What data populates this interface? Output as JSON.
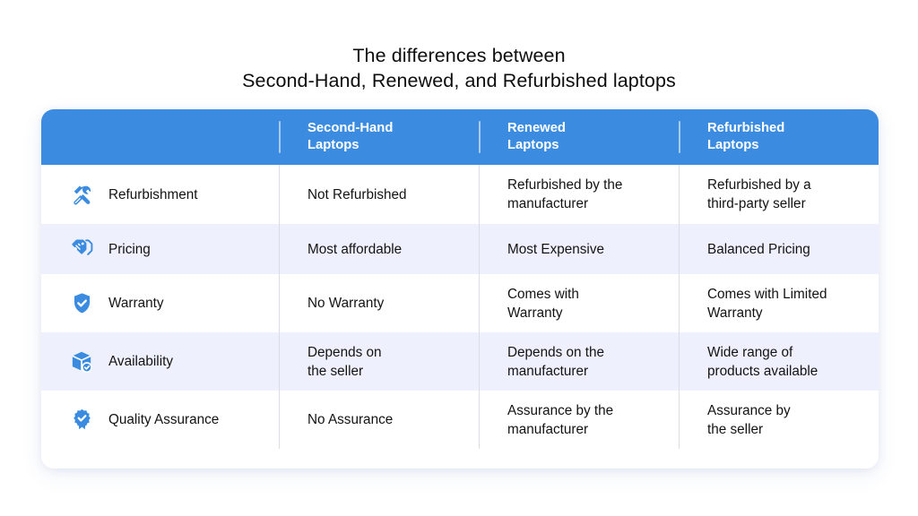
{
  "title": {
    "line1": "The differences between",
    "line2": "Second-Hand, Renewed, and Refurbished laptops"
  },
  "colors": {
    "header_blue": "#3b8ce0",
    "alt_row": "#eef1fd",
    "icon_blue": "#3b8ce0",
    "text": "#131313",
    "divider": "#dcdde3"
  },
  "table": {
    "headers": {
      "feature": "",
      "col1_line1": "Second-Hand",
      "col1_line2": "Laptops",
      "col2_line1": "Renewed",
      "col2_line2": "Laptops",
      "col3_line1": "Refurbished",
      "col3_line2": "Laptops"
    },
    "rows": [
      {
        "icon": "tools-icon",
        "feature": "Refurbishment",
        "col1": "Not Refurbished",
        "col2_line1": "Refurbished by the",
        "col2_line2": "manufacturer",
        "col3_line1": "Refurbished by a",
        "col3_line2": "third-party seller"
      },
      {
        "icon": "price-tag-icon",
        "feature": "Pricing",
        "col1": "Most affordable",
        "col2_line1": "Most Expensive",
        "col2_line2": "",
        "col3_line1": "Balanced Pricing",
        "col3_line2": ""
      },
      {
        "icon": "shield-check-icon",
        "feature": "Warranty",
        "col1": "No Warranty",
        "col2_line1": "Comes with",
        "col2_line2": "Warranty",
        "col3_line1": "Comes with Limited",
        "col3_line2": "Warranty"
      },
      {
        "icon": "package-check-icon",
        "feature": "Availability",
        "col1_line1": "Depends on",
        "col1_line2": "the seller",
        "col2_line1": "Depends on the",
        "col2_line2": "manufacturer",
        "col3_line1": "Wide range of",
        "col3_line2": "products available"
      },
      {
        "icon": "award-badge-icon",
        "feature": "Quality Assurance",
        "col1": "No Assurance",
        "col2_line1": "Assurance by the",
        "col2_line2": "manufacturer",
        "col3_line1": "Assurance by",
        "col3_line2": "the seller"
      }
    ]
  }
}
